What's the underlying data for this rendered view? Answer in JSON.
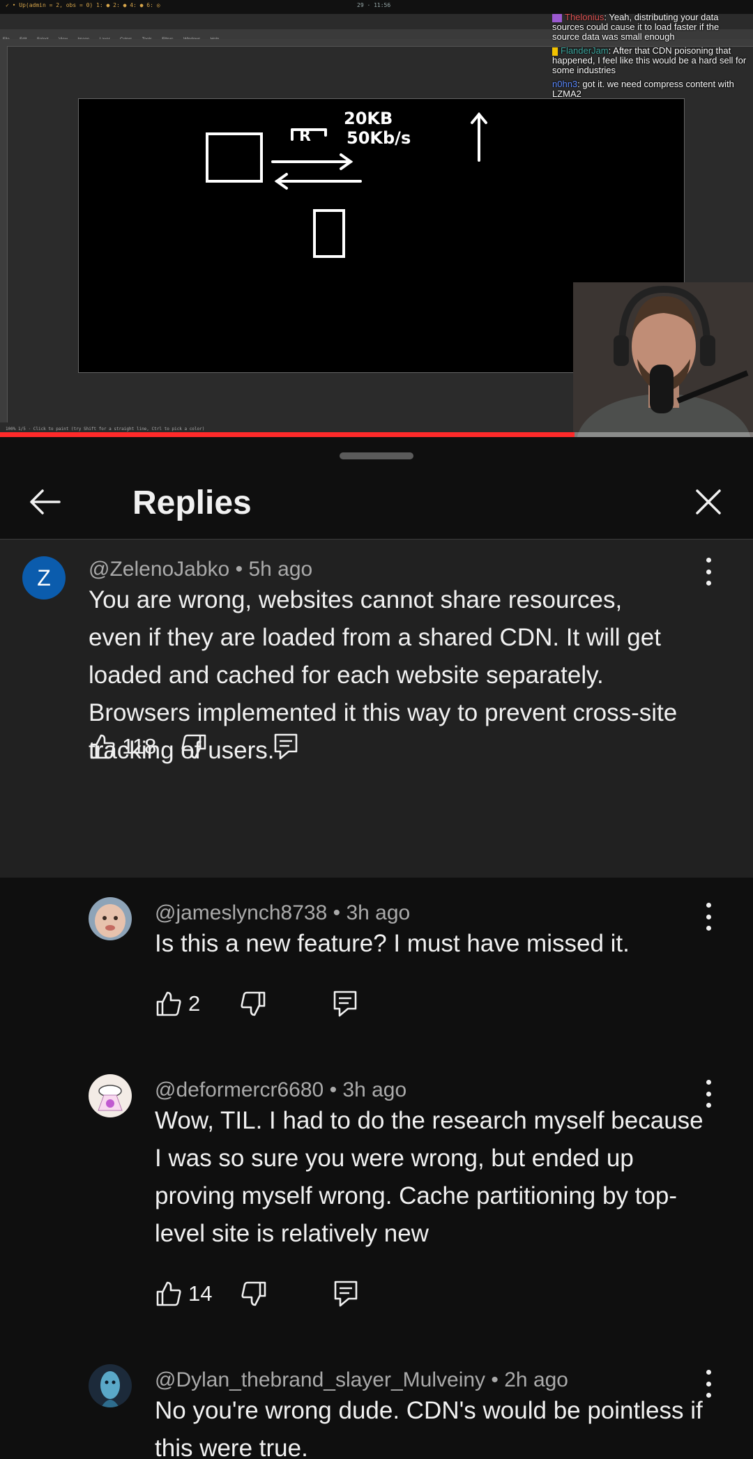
{
  "video": {
    "status_left": "✓ • Up(admin = 2, obs = 0)   1: ● 2: ● 4: ● 6: ◎",
    "status_mid": "29 · 11:56",
    "menu": [
      "File",
      "Edit",
      "Select",
      "View",
      "Image",
      "Layer",
      "Colors",
      "Tools",
      "Filters",
      "Windows",
      "Help"
    ],
    "statusline": "100% 1/5  ·  Click to paint (try Shift for a straight line, Ctrl to pick a color)",
    "drawing_labels": {
      "label_r": "R",
      "label_size": "20KB",
      "label_speed": "50Kb/s"
    },
    "chat": [
      {
        "user": "Thelonius",
        "text": ": Yeah, distributing your data sources could cause it to load faster if the source data was small enough"
      },
      {
        "user": "FlanderJam",
        "text": ": After that CDN poisoning that happened, I feel like this would be a hard sell for some industries"
      },
      {
        "user": "n0hn3",
        "text": ": got it. we need compress content with LZMA2"
      }
    ],
    "progress_fraction": 0.763,
    "progress_color": "#ff2a2a"
  },
  "panel": {
    "title": "Replies",
    "back_icon": "arrow-left-icon",
    "close_icon": "close-icon"
  },
  "parent_comment": {
    "avatar_letter": "Z",
    "avatar_color": "#0b5cad",
    "author": "@ZelenoJabko",
    "time": "5h ago",
    "text": "You are wrong, websites cannot share resources, even if they are loaded from a shared CDN. It will get loaded and cached for each website separately. Browsers implemented it this way to prevent cross-site tracking of users.",
    "likes": "118"
  },
  "replies": [
    {
      "author": "@jameslynch8738",
      "time": "3h ago",
      "text": "Is this a new feature? I must have missed it.",
      "likes": "2"
    },
    {
      "author": "@deformercr6680",
      "time": "3h ago",
      "text": "Wow, TIL. I had to do the research myself because I was so sure you were wrong, but ended up proving myself wrong. Cache partitioning by top-level site is relatively new",
      "likes": "14"
    },
    {
      "author": "@Dylan_thebrand_slayer_Mulveiny",
      "time": "2h ago",
      "text": "No you're wrong dude. CDN's would be pointless if this were true.",
      "likes": ""
    }
  ],
  "separator": " • "
}
